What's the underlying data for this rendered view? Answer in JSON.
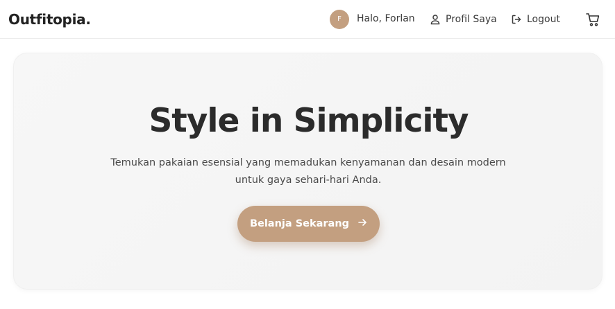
{
  "navbar": {
    "logo": "Outfitopia.",
    "avatar_initial": "F",
    "greeting": "Halo, Forlan",
    "profile_label": "Profil Saya",
    "logout_label": "Logout",
    "cart_icon": "cart-icon"
  },
  "hero": {
    "title": "Style in Simplicity",
    "subtitle": "Temukan pakaian esensial yang memadukan kenyamanan dan desain modern untuk gaya sehari-hari Anda.",
    "cta_label": "Belanja Sekarang",
    "cta_icon": "arrow-right-icon"
  },
  "colors": {
    "accent": "#c39f80",
    "text_dark": "#2b2b2b",
    "hero_bg": "#f5f5f5"
  }
}
